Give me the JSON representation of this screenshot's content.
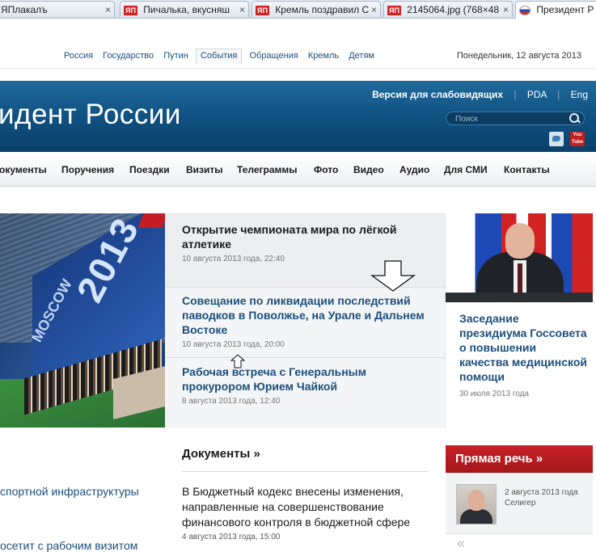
{
  "browser": {
    "tabs": [
      {
        "label": "ЯПлакалъ",
        "favicon": "yap-icon",
        "active": false
      },
      {
        "label": "Пичалька, вкусняш",
        "favicon": "yap-icon",
        "active": false
      },
      {
        "label": "Кремль поздравил С",
        "favicon": "yap-icon",
        "active": false
      },
      {
        "label": "2145064.jpg (768×48",
        "favicon": "yap-icon",
        "active": false
      },
      {
        "label": "Президент Р",
        "favicon": "russia-flag-icon",
        "active": true
      }
    ],
    "favicon_text": "ЯП",
    "close_glyph": "×"
  },
  "top": {
    "links": [
      "Россия",
      "Государство",
      "Путин",
      "События",
      "Обращения",
      "Кремль",
      "Детям"
    ],
    "selected": "События",
    "date": "Понедельник, 12 августа 2013"
  },
  "header": {
    "title": "идент России",
    "accessibility": "Версия для слабовидящих",
    "pda": "PDA",
    "lang": "Eng",
    "search_placeholder": "Поиск",
    "youtube_label": "You Tube"
  },
  "nav": {
    "items": [
      "окументы",
      "Поручения",
      "Поездки",
      "Визиты",
      "Телеграммы",
      "Фото",
      "Видео",
      "Аудио",
      "Для СМИ",
      "Контакты"
    ]
  },
  "featured": {
    "hero_text": {
      "year": "2013",
      "city": "MOSCOW"
    },
    "news": [
      {
        "title": "Открытие чемпионата мира по лёгкой атлетике",
        "date": "10 августа 2013 года, 22:40"
      },
      {
        "title": "Совещание по ликвидации последствий паводков в Поволжье, на Урале и Дальнем Востоке",
        "date": "10 августа 2013 года, 20:00"
      },
      {
        "title": "Рабочая встреча с Генеральным прокурором Юрием Чайкой",
        "date": "8 августа 2013 года, 12:40"
      }
    ],
    "side": {
      "title": "Заседание президиума Госсовета о повышении качества медицинской помощи",
      "date": "30 июля 2013 года"
    }
  },
  "lower": {
    "left_items": [
      "спортной инфраструктуры",
      "осетит с рабочим визитом"
    ],
    "docs_title": "Документы »",
    "doc": {
      "text": "В Бюджетный кодекс внесены изменения, направленные на совершенствование финансового контроля в бюджетной сфере",
      "date": "4 августа 2013 года, 15:00"
    },
    "direct_speech": {
      "title": "Прямая речь »",
      "date": "2 августа 2013 года",
      "place": "Селигер",
      "prev": "«"
    }
  },
  "colors": {
    "banner": "#0e4d7c",
    "link": "#1c4f7c",
    "accent_red": "#c72228"
  }
}
